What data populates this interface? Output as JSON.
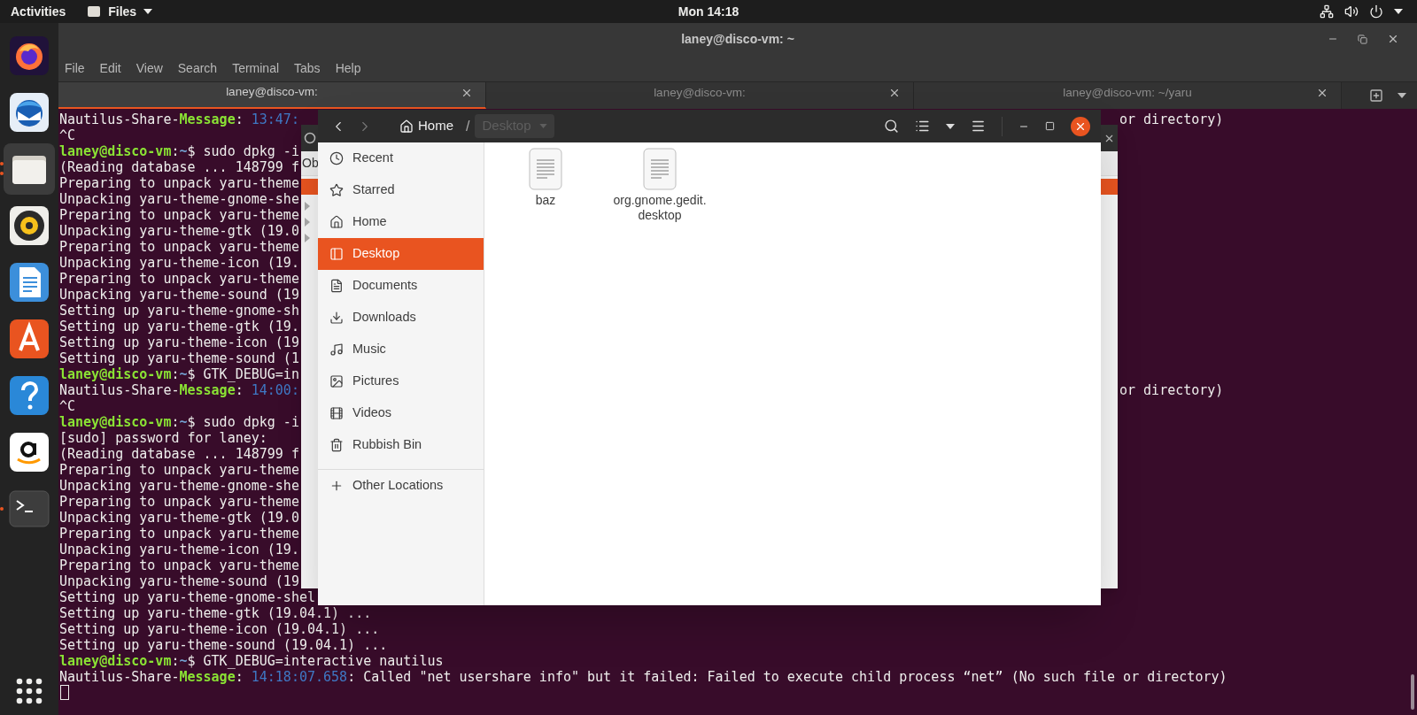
{
  "top_bar": {
    "activities": "Activities",
    "app_menu": "Files",
    "clock": "Mon 14:18"
  },
  "dock": {
    "items": [
      {
        "kind": "firefox",
        "active": false,
        "running": false
      },
      {
        "kind": "mail",
        "active": false,
        "running": false
      },
      {
        "kind": "files",
        "active": true,
        "running": true,
        "multiple": true
      },
      {
        "kind": "music",
        "active": false,
        "running": false
      },
      {
        "kind": "writer",
        "active": false,
        "running": false
      },
      {
        "kind": "software",
        "active": false,
        "running": false
      },
      {
        "kind": "help",
        "active": false,
        "running": false
      },
      {
        "kind": "shop",
        "active": false,
        "running": false
      },
      {
        "kind": "terminal",
        "active": false,
        "running": true,
        "multiple": false
      }
    ]
  },
  "terminal": {
    "title": "laney@disco-vm: ~",
    "menu": [
      "File",
      "Edit",
      "View",
      "Search",
      "Terminal",
      "Tabs",
      "Help"
    ],
    "tabs": [
      {
        "label": "laney@disco-vm:",
        "selected": true
      },
      {
        "label": "laney@disco-vm:",
        "selected": false
      },
      {
        "label": "laney@disco-vm: ~/yaru",
        "selected": false
      }
    ],
    "lines": [
      {
        "segments": [
          {
            "kind": "text",
            "text": "Nautilus-Share-"
          },
          {
            "kind": "label",
            "text": "Message"
          },
          {
            "kind": "text",
            "text": ": "
          },
          {
            "kind": "time",
            "text": "13:47:"
          }
        ],
        "right": "or directory)"
      },
      {
        "segments": [
          {
            "kind": "text",
            "text": "^C"
          }
        ]
      },
      {
        "segments": [
          {
            "kind": "user",
            "text": "laney@disco-vm"
          },
          {
            "kind": "text",
            "text": ":"
          },
          {
            "kind": "path",
            "text": "~"
          },
          {
            "kind": "text",
            "text": "$ sudo dpkg -i"
          }
        ]
      },
      {
        "segments": [
          {
            "kind": "text",
            "text": "(Reading database ... 148799 f"
          }
        ]
      },
      {
        "segments": [
          {
            "kind": "text",
            "text": "Preparing to unpack yaru-theme"
          }
        ]
      },
      {
        "segments": [
          {
            "kind": "text",
            "text": "Unpacking yaru-theme-gnome-she"
          }
        ]
      },
      {
        "segments": [
          {
            "kind": "text",
            "text": "Preparing to unpack yaru-theme"
          }
        ]
      },
      {
        "segments": [
          {
            "kind": "text",
            "text": "Unpacking yaru-theme-gtk (19.0"
          }
        ]
      },
      {
        "segments": [
          {
            "kind": "text",
            "text": "Preparing to unpack yaru-theme"
          }
        ]
      },
      {
        "segments": [
          {
            "kind": "text",
            "text": "Unpacking yaru-theme-icon (19."
          }
        ]
      },
      {
        "segments": [
          {
            "kind": "text",
            "text": "Preparing to unpack yaru-theme"
          }
        ]
      },
      {
        "segments": [
          {
            "kind": "text",
            "text": "Unpacking yaru-theme-sound (19"
          }
        ]
      },
      {
        "segments": [
          {
            "kind": "text",
            "text": "Setting up yaru-theme-gnome-sh"
          }
        ]
      },
      {
        "segments": [
          {
            "kind": "text",
            "text": "Setting up yaru-theme-gtk (19."
          }
        ]
      },
      {
        "segments": [
          {
            "kind": "text",
            "text": "Setting up yaru-theme-icon (19"
          }
        ]
      },
      {
        "segments": [
          {
            "kind": "text",
            "text": "Setting up yaru-theme-sound (1"
          }
        ]
      },
      {
        "segments": [
          {
            "kind": "user",
            "text": "laney@disco-vm"
          },
          {
            "kind": "text",
            "text": ":"
          },
          {
            "kind": "path",
            "text": "~"
          },
          {
            "kind": "text",
            "text": "$ GTK_DEBUG=in"
          }
        ]
      },
      {
        "segments": [
          {
            "kind": "text",
            "text": "Nautilus-Share-"
          },
          {
            "kind": "label",
            "text": "Message"
          },
          {
            "kind": "text",
            "text": ": "
          },
          {
            "kind": "time",
            "text": "14:00:"
          }
        ],
        "right": "or directory)"
      },
      {
        "segments": [
          {
            "kind": "text",
            "text": "^C"
          }
        ]
      },
      {
        "segments": [
          {
            "kind": "user",
            "text": "laney@disco-vm"
          },
          {
            "kind": "text",
            "text": ":"
          },
          {
            "kind": "path",
            "text": "~"
          },
          {
            "kind": "text",
            "text": "$ sudo dpkg -i"
          }
        ]
      },
      {
        "segments": [
          {
            "kind": "text",
            "text": "[sudo] password for laney:"
          }
        ]
      },
      {
        "segments": [
          {
            "kind": "text",
            "text": "(Reading database ... 148799 f"
          }
        ]
      },
      {
        "segments": [
          {
            "kind": "text",
            "text": "Preparing to unpack yaru-theme"
          }
        ]
      },
      {
        "segments": [
          {
            "kind": "text",
            "text": "Unpacking yaru-theme-gnome-she"
          }
        ]
      },
      {
        "segments": [
          {
            "kind": "text",
            "text": "Preparing to unpack yaru-theme"
          }
        ]
      },
      {
        "segments": [
          {
            "kind": "text",
            "text": "Unpacking yaru-theme-gtk (19.0"
          }
        ]
      },
      {
        "segments": [
          {
            "kind": "text",
            "text": "Preparing to unpack yaru-theme"
          }
        ]
      },
      {
        "segments": [
          {
            "kind": "text",
            "text": "Unpacking yaru-theme-icon (19."
          }
        ]
      },
      {
        "segments": [
          {
            "kind": "text",
            "text": "Preparing to unpack yaru-theme"
          }
        ]
      },
      {
        "segments": [
          {
            "kind": "text",
            "text": "Unpacking yaru-theme-sound (19"
          }
        ]
      },
      {
        "segments": [
          {
            "kind": "text",
            "text": "Setting up yaru-theme-gnome-shel"
          }
        ]
      },
      {
        "segments": [
          {
            "kind": "text",
            "text": "Setting up yaru-theme-gtk (19.04.1) ..."
          }
        ]
      },
      {
        "segments": [
          {
            "kind": "text",
            "text": "Setting up yaru-theme-icon (19.04.1) ..."
          }
        ]
      },
      {
        "segments": [
          {
            "kind": "text",
            "text": "Setting up yaru-theme-sound (19.04.1) ..."
          }
        ]
      },
      {
        "segments": [
          {
            "kind": "user",
            "text": "laney@disco-vm"
          },
          {
            "kind": "text",
            "text": ":"
          },
          {
            "kind": "path",
            "text": "~"
          },
          {
            "kind": "text",
            "text": "$ GTK_DEBUG=interactive nautilus"
          }
        ]
      },
      {
        "segments": [
          {
            "kind": "text",
            "text": "Nautilus-Share-"
          },
          {
            "kind": "label",
            "text": "Message"
          },
          {
            "kind": "text",
            "text": ": "
          },
          {
            "kind": "time",
            "text": "14:18:07.658"
          },
          {
            "kind": "text",
            "text": ": Called \"net usershare info\" but it failed: Failed to execute child process “net” (No such file or directory)"
          }
        ]
      }
    ]
  },
  "back_dialog": {
    "label": "Ob"
  },
  "files": {
    "path": [
      {
        "label": "Home",
        "kind": "home",
        "selected": false
      },
      {
        "label": "Desktop",
        "kind": "folder",
        "selected": true
      }
    ],
    "separator": "/",
    "sidebar": [
      {
        "label": "Recent",
        "selected": false
      },
      {
        "label": "Starred",
        "selected": false
      },
      {
        "label": "Home",
        "selected": false
      },
      {
        "label": "Desktop",
        "selected": true
      },
      {
        "label": "Documents",
        "selected": false
      },
      {
        "label": "Downloads",
        "selected": false
      },
      {
        "label": "Music",
        "selected": false
      },
      {
        "label": "Pictures",
        "selected": false
      },
      {
        "label": "Videos",
        "selected": false
      },
      {
        "label": "Rubbish Bin",
        "selected": false
      }
    ],
    "other_locations": {
      "label": "Other Locations"
    },
    "items": [
      {
        "name": "baz"
      },
      {
        "name": "org.gnome.gedit.desktop"
      }
    ]
  }
}
